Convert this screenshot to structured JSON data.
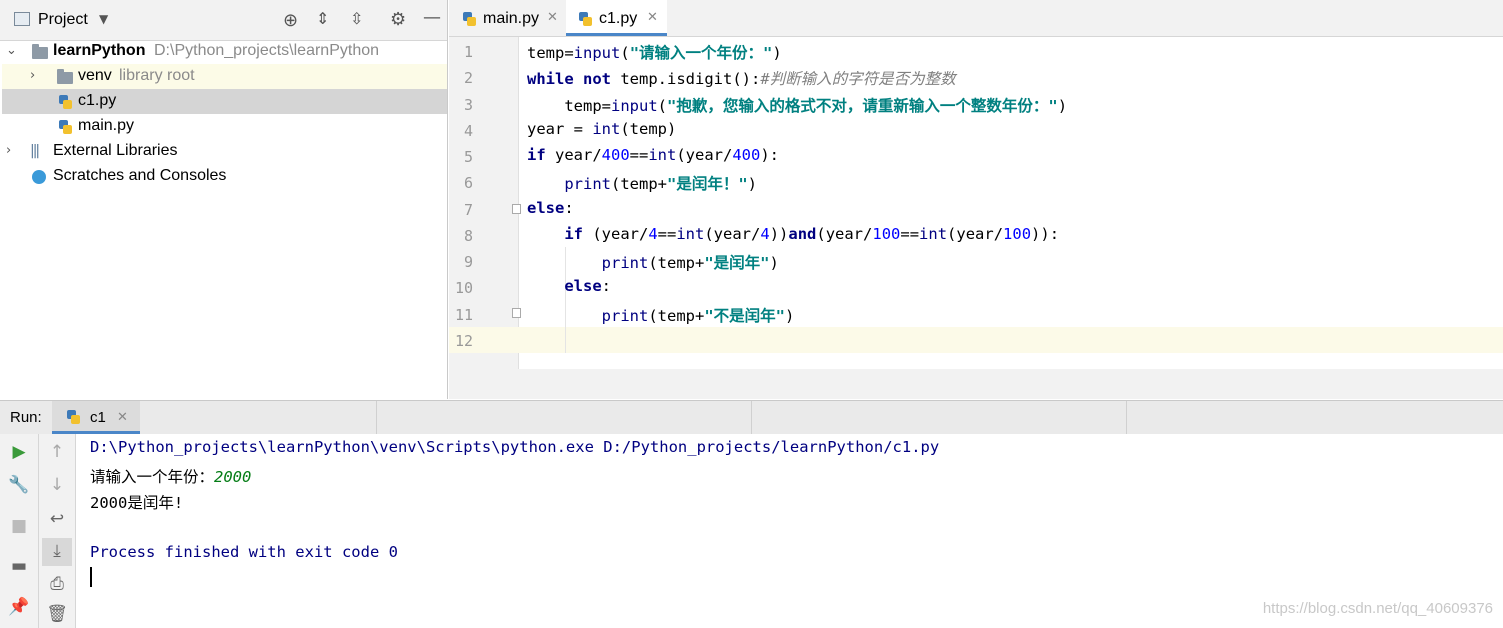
{
  "project_panel": {
    "title": "Project",
    "tree": {
      "root_name": "learnPython",
      "root_path": "D:\\Python_projects\\learnPython",
      "venv_name": "venv",
      "venv_hint": "library root",
      "file_c1": "c1.py",
      "file_main": "main.py",
      "external_libraries": "External Libraries",
      "scratches": "Scratches and Consoles"
    }
  },
  "editor": {
    "tabs": [
      {
        "label": "main.py",
        "active": false
      },
      {
        "label": "c1.py",
        "active": true
      }
    ],
    "line_numbers": [
      "1",
      "2",
      "3",
      "4",
      "5",
      "6",
      "7",
      "8",
      "9",
      "10",
      "11",
      "12"
    ],
    "code": {
      "l1": {
        "a": "temp=",
        "b": "input",
        "c": "(",
        "d": "\"请输入一个年份：\"",
        "e": ")"
      },
      "l2": {
        "a": "while",
        "b": " ",
        "c": "not",
        "d": " temp.isdigit():",
        "e": "#判断输入的字符是否为整数"
      },
      "l3": {
        "a": "    temp=",
        "b": "input",
        "c": "(",
        "d": "\"抱歉，您输入的格式不对，请重新输入一个整数年份：\"",
        "e": ")"
      },
      "l4": {
        "a": "year = ",
        "b": "int",
        "c": "(temp)"
      },
      "l5": {
        "a": "if",
        "b": " year/",
        "c": "400",
        "d": "==",
        "e": "int",
        "f": "(year/",
        "g": "400",
        "h": "):"
      },
      "l6": {
        "a": "    ",
        "b": "print",
        "c": "(temp+",
        "d": "\"是闰年！\"",
        "e": ")"
      },
      "l7": {
        "a": "else",
        "b": ":"
      },
      "l8": {
        "a": "    ",
        "b": "if",
        "c": " (year/",
        "d": "4",
        "e": "==",
        "f": "int",
        "g": "(year/",
        "h": "4",
        "i": "))",
        "j": "and",
        "k": "(year/",
        "l": "100",
        "m": "==",
        "n": "int",
        "o": "(year/",
        "p": "100",
        "q": ")):"
      },
      "l9": {
        "a": "        ",
        "b": "print",
        "c": "(temp+",
        "d": "\"是闰年\"",
        "e": ")"
      },
      "l10": {
        "a": "    ",
        "b": "else",
        "c": ":"
      },
      "l11": {
        "a": "        ",
        "b": "print",
        "c": "(temp+",
        "d": "\"不是闰年\"",
        "e": ")"
      }
    }
  },
  "run_panel": {
    "label": "Run:",
    "tab_label": "c1",
    "console": {
      "command": "D:\\Python_projects\\learnPython\\venv\\Scripts\\python.exe D:/Python_projects/learnPython/c1.py",
      "prompt": "请输入一个年份：",
      "input_value": "2000",
      "result": "2000是闰年!",
      "finished": "Process finished with exit code 0"
    }
  },
  "watermark": "https://blog.csdn.net/qq_40609376",
  "colors": {
    "keyword": "#000080",
    "string": "#008080",
    "number": "#0000ff",
    "comment": "#808080",
    "accent": "#4a86c8"
  }
}
